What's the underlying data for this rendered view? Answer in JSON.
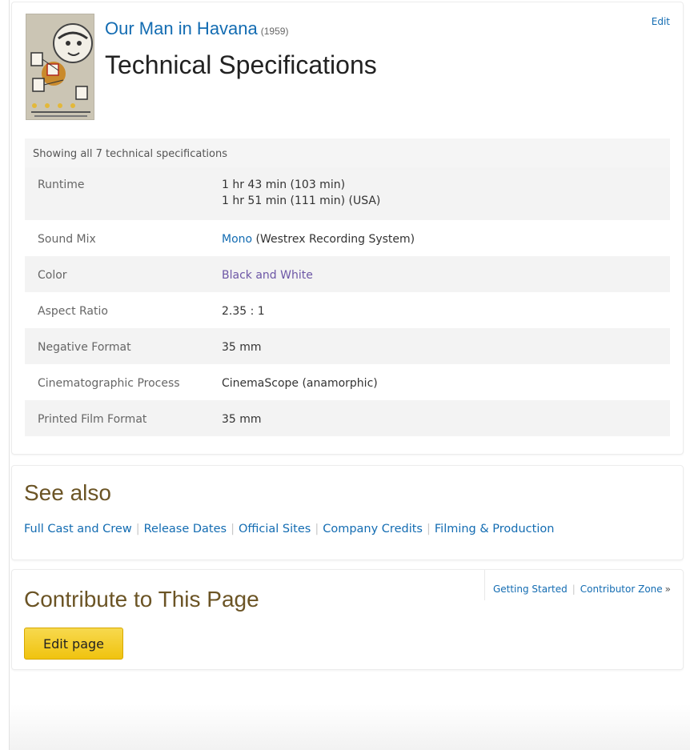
{
  "header": {
    "movie_title": "Our Man in Havana",
    "movie_year": "(1959)",
    "page_title": "Technical Specifications",
    "edit_label": "Edit"
  },
  "specs": {
    "caption": "Showing all 7 technical specifications",
    "rows": [
      {
        "label": "Runtime",
        "values": [
          "1 hr 43 min (103 min)",
          "1 hr 51 min (111 min) (USA)"
        ]
      },
      {
        "label": "Sound Mix",
        "link": "Mono",
        "suffix": " (Westrex Recording System)"
      },
      {
        "label": "Color",
        "link": "Black and White"
      },
      {
        "label": "Aspect Ratio",
        "value": "2.35 : 1"
      },
      {
        "label": "Negative Format",
        "value": "35 mm"
      },
      {
        "label": "Cinematographic Process",
        "value": "CinemaScope (anamorphic)"
      },
      {
        "label": "Printed Film Format",
        "value": "35 mm"
      }
    ]
  },
  "see_also": {
    "heading": "See also",
    "links": [
      "Full Cast and Crew",
      "Release Dates",
      "Official Sites",
      "Company Credits",
      "Filming & Production"
    ],
    "separator": "|"
  },
  "contribute": {
    "heading": "Contribute to This Page",
    "getting_started": "Getting Started",
    "contributor_zone": "Contributor Zone",
    "raquo": "»",
    "edit_button": "Edit page"
  },
  "colors": {
    "link": "#136cb2",
    "visited_link": "#6d57a6",
    "heading_brown": "#6b5425",
    "button_yellow": "#f5c518"
  }
}
